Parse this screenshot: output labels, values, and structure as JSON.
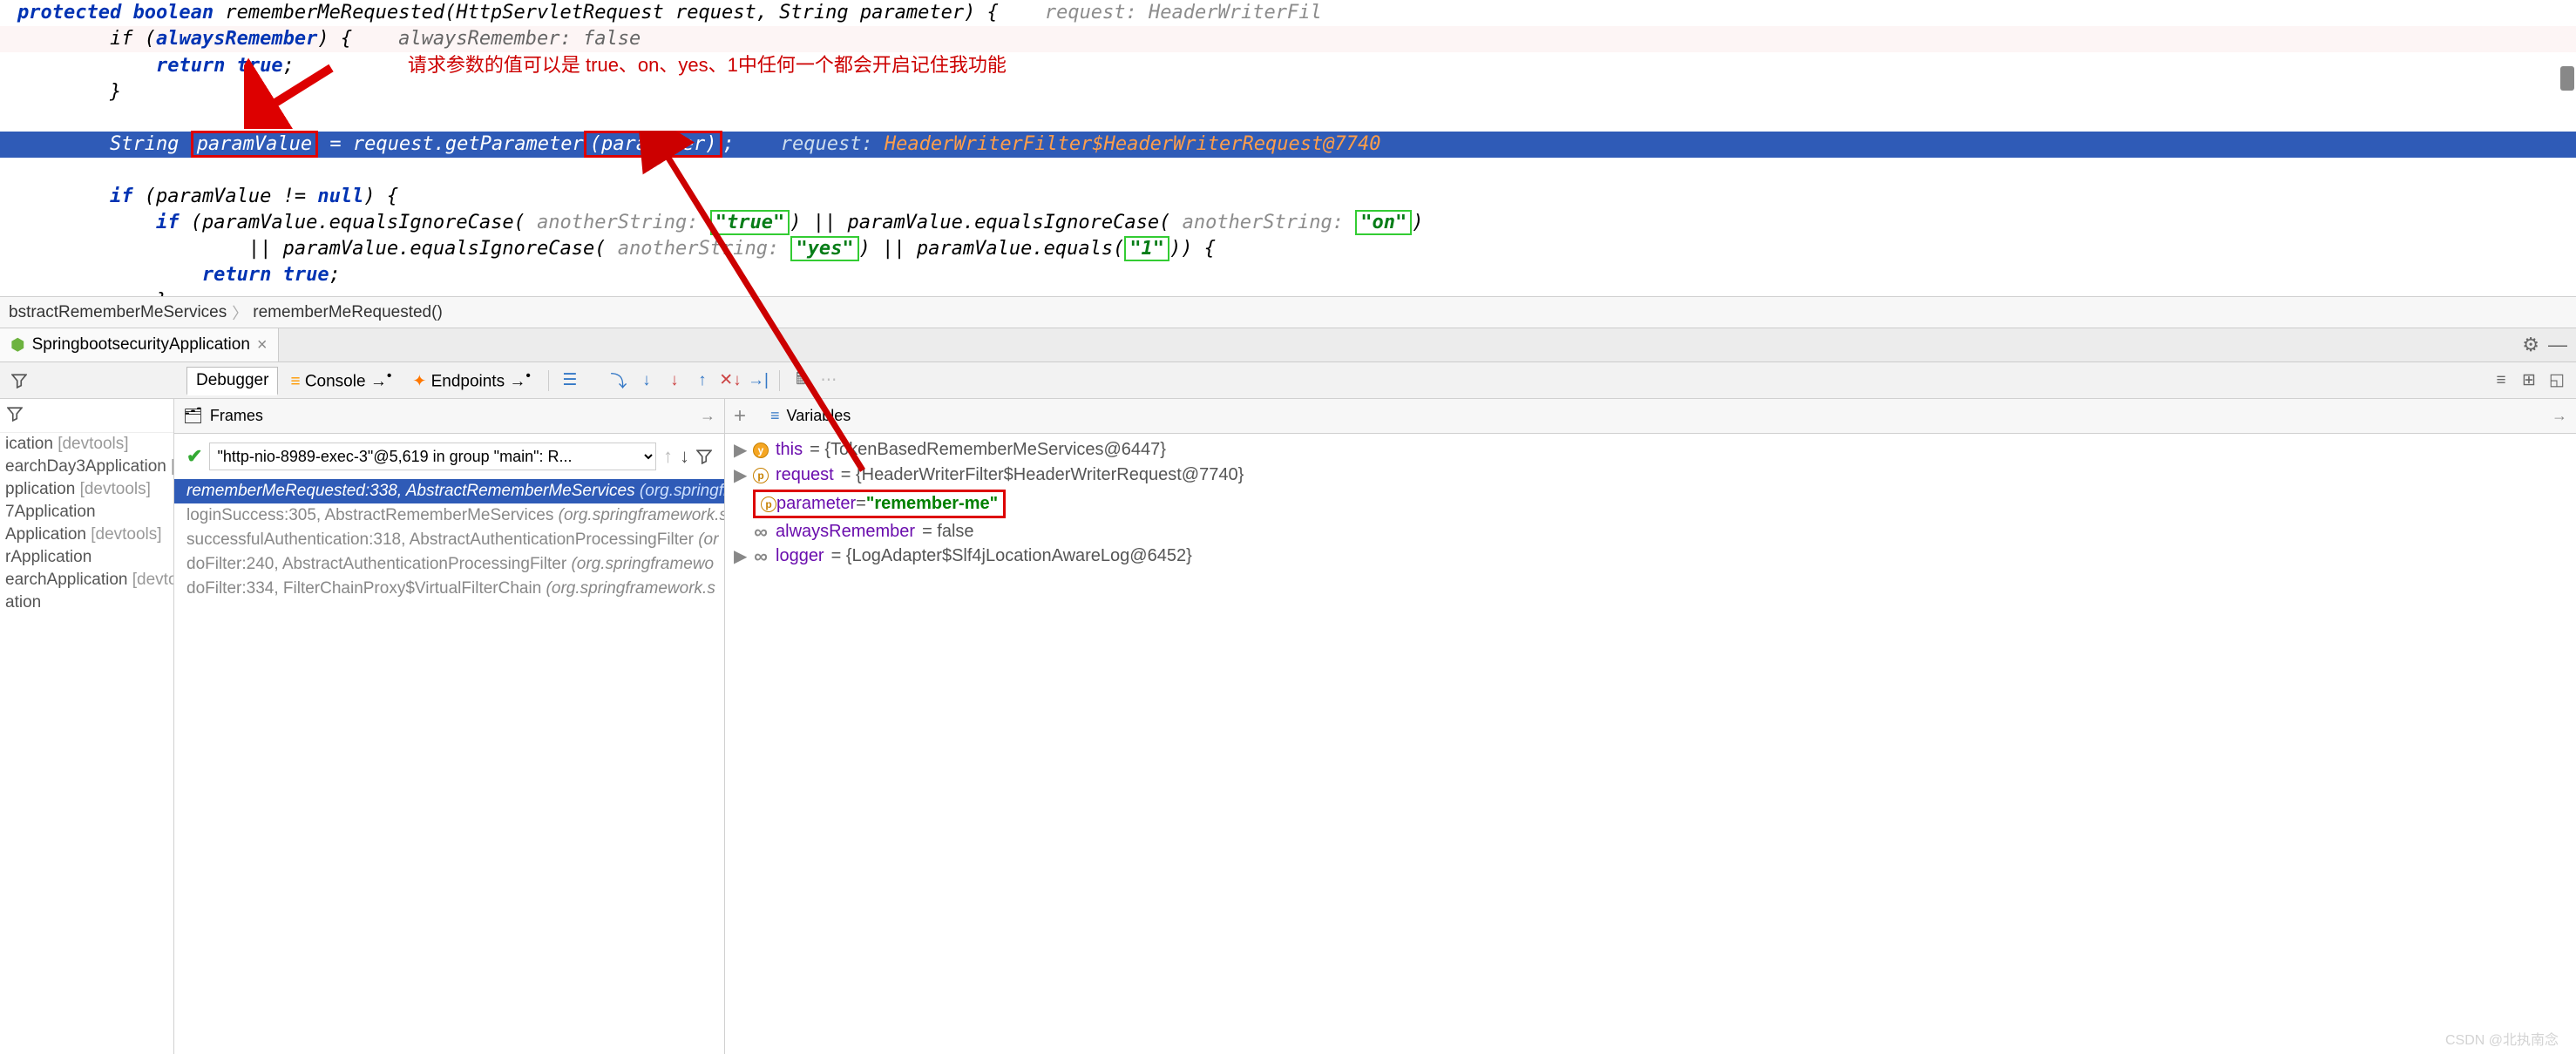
{
  "code": {
    "l1_pre": "    protected boolean rememberMeRequested(HttpServletRequest request, String parameter) {    ",
    "l1_hint": "request: HeaderWriterFil",
    "l2_pre": "        if (",
    "l2_var": "alwaysRemember",
    "l2_post": ") {    ",
    "l2_hint": "alwaysRemember: false",
    "l3": "            return true;",
    "annot": "请求参数的值可以是 true、on、yes、1中任何一个都会开启记住我功能",
    "l4": "        }",
    "l6_a": "        String ",
    "l6_box": "paramValue",
    "l6_b": " = request.getParameter",
    "l6_c": "(parameter)",
    "l6_d": ";    ",
    "l6_hint1": "request: ",
    "l6_hint2": "HeaderWriterFilter$HeaderWriterRequest@7740",
    "l8": "        if (paramValue != null) {",
    "l9a": "            if (paramValue.equalsIgnoreCase( ",
    "h_as": "anotherString: ",
    "s_true": "\"true\"",
    "l9b": ") || paramValue.equalsIgnoreCase( ",
    "s_on": "\"on\"",
    "l9c": ")",
    "l10a": "                    || paramValue.equalsIgnoreCase( ",
    "s_yes": "\"yes\"",
    "l10b": ") || paramValue.equals(",
    "s_1": "\"1\"",
    "l10c": ")) {",
    "l11": "                return true;",
    "l12": "            }",
    "l13": "        }"
  },
  "breadcrumb": {
    "a": "bstractRememberMeServices",
    "b": "rememberMeRequested()"
  },
  "runtab": "SpringbootsecurityApplication",
  "toolbar": {
    "debugger": "Debugger",
    "console": "Console",
    "endpoints": "Endpoints"
  },
  "leftpanel": {
    "items": [
      {
        "t": "ication",
        "s": "[devtools]"
      },
      {
        "t": "earchDay3Application",
        "s": "[devtools]"
      },
      {
        "t": "pplication",
        "s": "[devtools]"
      },
      {
        "t": "7Application",
        "s": ""
      },
      {
        "t": "Application",
        "s": "[devtools]"
      },
      {
        "t": "rApplication",
        "s": ""
      },
      {
        "t": "earchApplication",
        "s": "[devtools]"
      },
      {
        "t": "ation",
        "s": ""
      }
    ]
  },
  "frames": {
    "title": "Frames",
    "thread": "\"http-nio-8989-exec-3\"@5,619 in group \"main\": R...",
    "stack": [
      {
        "m": "rememberMeRequested:338, AbstractRememberMeServices",
        "p": "(org.springfr",
        "cur": true
      },
      {
        "m": "loginSuccess:305, AbstractRememberMeServices",
        "p": "(org.springframework.s"
      },
      {
        "m": "successfulAuthentication:318, AbstractAuthenticationProcessingFilter",
        "p": "(or"
      },
      {
        "m": "doFilter:240, AbstractAuthenticationProcessingFilter",
        "p": "(org.springframewo"
      },
      {
        "m": "doFilter:334, FilterChainProxy$VirtualFilterChain",
        "p": "(org.springframework.s"
      }
    ]
  },
  "vars": {
    "title": "Variables",
    "rows": [
      {
        "icon": "y",
        "chev": "▶",
        "name": "this",
        "val": "= {TokenBasedRememberMeServices@6447}"
      },
      {
        "icon": "p",
        "chev": "▶",
        "name": "request",
        "val": "= {HeaderWriterFilter$HeaderWriterRequest@7740}"
      },
      {
        "icon": "p",
        "chev": "",
        "name": "parameter",
        "val": "= ",
        "str": "\"remember-me\"",
        "boxed": true
      },
      {
        "icon": "inf",
        "chev": "",
        "name": "alwaysRemember",
        "val": "= false"
      },
      {
        "icon": "inf",
        "chev": "▶",
        "name": "logger",
        "val": "= {LogAdapter$Slf4jLocationAwareLog@6452}"
      }
    ]
  },
  "watermark": "CSDN @北执南念"
}
